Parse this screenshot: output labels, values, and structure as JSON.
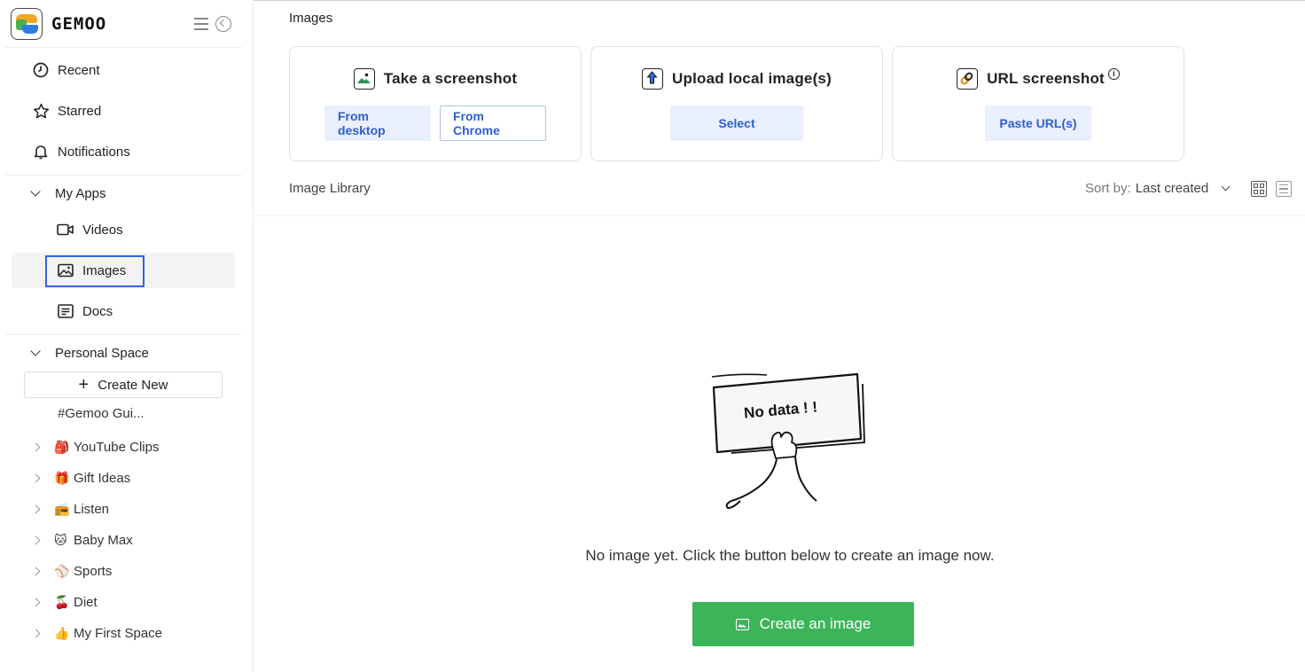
{
  "app": {
    "brand": "GEMOO"
  },
  "nav": {
    "recent": "Recent",
    "starred": "Starred",
    "notifications": "Notifications",
    "my_apps": "My Apps",
    "videos": "Videos",
    "images": "Images",
    "docs": "Docs",
    "personal_space": "Personal Space",
    "create_new": "Create New"
  },
  "spaces": {
    "guide": "#Gemoo Gui...",
    "items": [
      {
        "emoji": "🎒",
        "label": "YouTube Clips"
      },
      {
        "emoji": "🎁",
        "label": "Gift Ideas"
      },
      {
        "emoji": "📻",
        "label": "Listen"
      },
      {
        "emoji": "🐱",
        "label": "Baby Max"
      },
      {
        "emoji": "⚾",
        "label": "Sports"
      },
      {
        "emoji": "🍒",
        "label": "Diet"
      },
      {
        "emoji": "👍",
        "label": "My First Space"
      }
    ]
  },
  "main": {
    "title": "Images",
    "cards": {
      "screenshot": {
        "title": "Take a screenshot",
        "btn1": "From desktop",
        "btn2": "From Chrome"
      },
      "upload": {
        "title": "Upload local image(s)",
        "btn": "Select"
      },
      "url": {
        "title": "URL screenshot",
        "btn": "Paste URL(s)",
        "info": "i"
      }
    },
    "library": {
      "label": "Image Library",
      "sort_label": "Sort by:",
      "sort_value": "Last created"
    },
    "empty": {
      "sign": "No data ! !",
      "message": "No image yet. Click the button below to create an image now.",
      "button": "Create an image"
    }
  },
  "colors": {
    "accent": "#2f5fd0",
    "primary_button": "#3cb55a",
    "active_outline": "#2f66d8"
  }
}
